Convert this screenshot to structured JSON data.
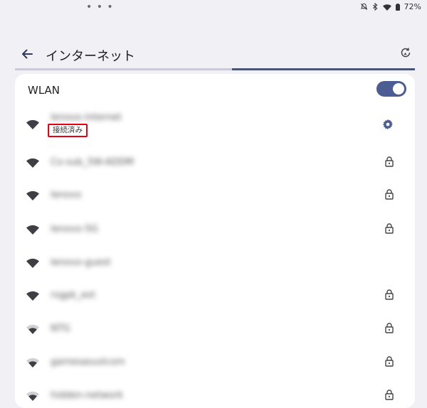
{
  "status_bar": {
    "dots": "• • •",
    "battery": "72%",
    "icons": [
      "mute-icon",
      "bluetooth-icon",
      "wifi-icon",
      "battery-icon"
    ]
  },
  "header": {
    "title": "インターネット",
    "back_icon": "arrow-left-icon",
    "refresh_icon": "refresh-icon"
  },
  "wlan": {
    "label": "WLAN",
    "enabled": true
  },
  "networks": [
    {
      "ssid": "lenovo-internet",
      "status": "接続済み",
      "right_icon": "gear-icon",
      "signal": "full"
    },
    {
      "ssid": "Co-sub_5W-ADDM",
      "status": "",
      "right_icon": "lock-icon",
      "signal": "full"
    },
    {
      "ssid": "lenovo",
      "status": "",
      "right_icon": "lock-icon",
      "signal": "full"
    },
    {
      "ssid": "lenovo-5G",
      "status": "",
      "right_icon": "lock-icon",
      "signal": "full"
    },
    {
      "ssid": "lenovo-guest",
      "status": "",
      "right_icon": "",
      "signal": "full"
    },
    {
      "ssid": "rsgpk_ext",
      "status": "",
      "right_icon": "lock-icon",
      "signal": "full"
    },
    {
      "ssid": "NTG",
      "status": "",
      "right_icon": "lock-icon",
      "signal": "medium"
    },
    {
      "ssid": "gamesasuslcom",
      "status": "",
      "right_icon": "lock-icon",
      "signal": "medium"
    },
    {
      "ssid": "hidden-network",
      "status": "",
      "right_icon": "lock-icon",
      "signal": "medium"
    }
  ],
  "colors": {
    "accent": "#4b5d92",
    "highlight": "#e60012",
    "background": "#f1f0f5",
    "card": "#ffffff"
  }
}
